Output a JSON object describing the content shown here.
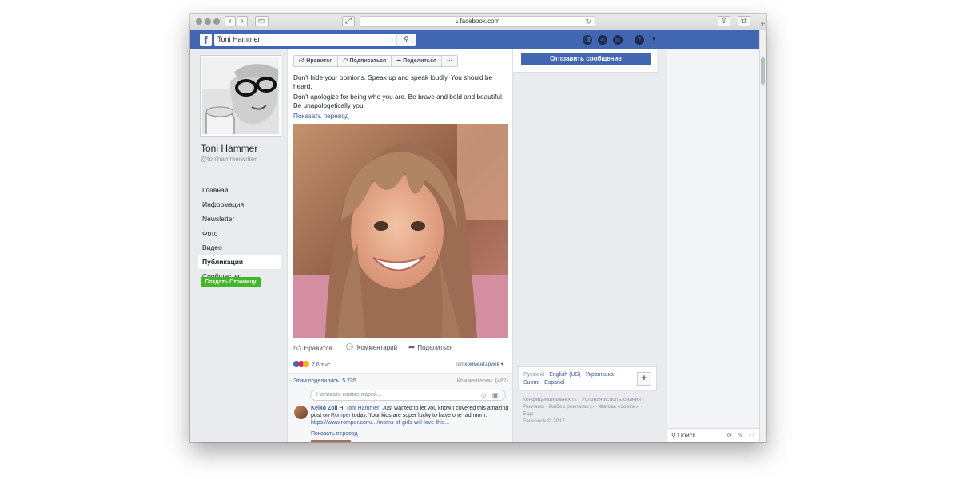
{
  "browser": {
    "url": "facebook.com",
    "lock_icon": "lock-icon",
    "reload_icon": "reload-icon"
  },
  "topbar": {
    "search_value": "Toni Hammer",
    "icons": [
      "friends-icon",
      "messenger-icon",
      "globe-icon",
      "help-icon",
      "caret-down-icon"
    ]
  },
  "profile": {
    "name": "Toni Hammer",
    "handle": "@tonihammerwriter"
  },
  "nav": {
    "items": [
      {
        "label": "Главная"
      },
      {
        "label": "Информация"
      },
      {
        "label": "Newsletter"
      },
      {
        "label": "Фото"
      },
      {
        "label": "Видео"
      },
      {
        "label": "Публикации"
      },
      {
        "label": "Сообщество"
      }
    ],
    "active_index": 5,
    "create_page": "Создать Страницу"
  },
  "actions": {
    "like": "Нравится",
    "follow": "Подписаться",
    "share": "Поделиться",
    "more": "···"
  },
  "post": {
    "line1": "Don't hide your opinions. Speak up and speak loudly. You should be heard.",
    "line2": "Don't apologize for being who you are. Be brave and bold and beautiful. Be unapologetically you.",
    "see_translation": "Показать перевод",
    "like_btn": "Нравится",
    "comment_btn": "Комментарий",
    "share_btn": "Поделиться",
    "reactions_count": "7,6 тыс.",
    "top_comments": "Топ комментариев",
    "shared_count": "Этим поделились: 5 735",
    "comments_count": "Комментарии: (487)",
    "comment_placeholder": "Написать комментарий..."
  },
  "comment": {
    "author": "Keiko Zoll",
    "hi": "Hi",
    "mention": "Toni Hammer",
    "text1": ": Just wanted to let you know I covered this amazing post on",
    "romper": "Romper",
    "text2": "today. Your kids are super lucky to have one rad mom.",
    "link": "https://www.romper.com/.../moms-of-girls-will-love-this...",
    "see_translation": "Показать перевод"
  },
  "sidebar": {
    "send_message": "Отправить сообщение",
    "languages": [
      "Русский",
      "English (US)",
      "Українська",
      "Suomi",
      "Español"
    ],
    "plus": "+",
    "footer_links": [
      "Конфиденциальность",
      "Условия использования",
      "Реклама",
      "Выбор рекламы",
      "Файлы «cookie»",
      "Еще"
    ],
    "copyright": "Facebook © 2017"
  },
  "chat": {
    "search_placeholder": "Поиск"
  },
  "colors": {
    "fb_blue": "#4267b2",
    "link": "#385898",
    "create_green": "#42b72a"
  }
}
